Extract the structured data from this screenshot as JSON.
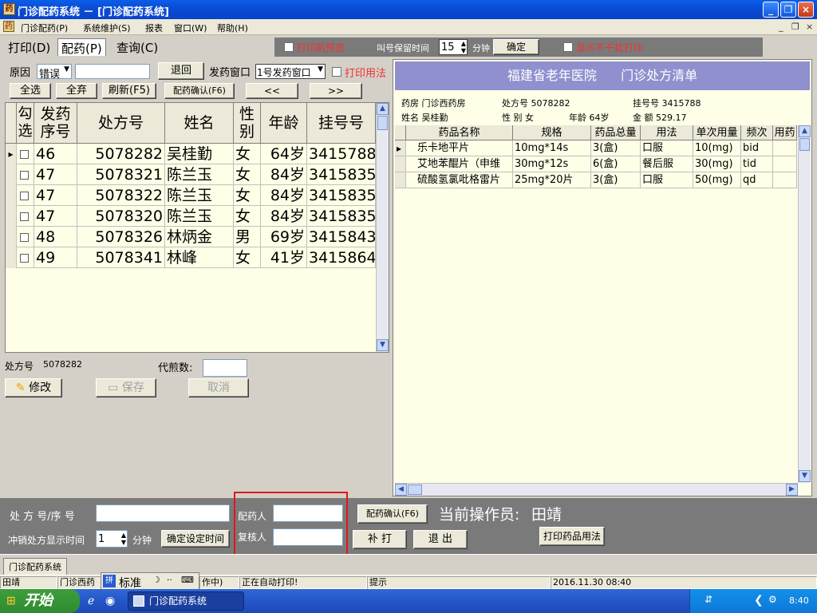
{
  "window": {
    "title": "门诊配药系统 － [门诊配药系统]"
  },
  "menu": [
    "门诊配药(P)",
    "系统维护(S)",
    "报表",
    "窗口(W)",
    "帮助(H)"
  ],
  "mdi_controls": [
    "_",
    "❐",
    "×"
  ],
  "tabs": [
    "打印(D)",
    "配药(P)",
    "查询(C)"
  ],
  "toolbar": {
    "print_preview": "打印前预览",
    "call_keep_label": "叫号保留时间",
    "call_keep_value": "15",
    "minutes": "分钟",
    "confirm": "确定",
    "no_interfere": "显示不干扰打印"
  },
  "left": {
    "reason_label": "原因",
    "reason_value": "错误",
    "return_btn": "退回",
    "window_label": "发药窗口",
    "window_value": "1号发药窗口",
    "print_usage": "打印用法",
    "select_all": "全选",
    "deselect_all": "全弃",
    "refresh": "刷新(F5)",
    "confirm_f6": "配药确认(F6)",
    "prev": "<<",
    "next": ">>",
    "headers": [
      "勾选",
      "发药序号",
      "处方号",
      "姓名",
      "性别",
      "年龄",
      "挂号号"
    ],
    "rows": [
      {
        "seq": "46",
        "rx": "5078282",
        "name": "吴桂勤",
        "sex": "女",
        "age": "64岁",
        "reg": "3415788"
      },
      {
        "seq": "47",
        "rx": "5078321",
        "name": "陈兰玉",
        "sex": "女",
        "age": "84岁",
        "reg": "3415835"
      },
      {
        "seq": "47",
        "rx": "5078322",
        "name": "陈兰玉",
        "sex": "女",
        "age": "84岁",
        "reg": "3415835"
      },
      {
        "seq": "47",
        "rx": "5078320",
        "name": "陈兰玉",
        "sex": "女",
        "age": "84岁",
        "reg": "3415835"
      },
      {
        "seq": "48",
        "rx": "5078326",
        "name": "林炳金",
        "sex": "男",
        "age": "69岁",
        "reg": "3415843"
      },
      {
        "seq": "49",
        "rx": "5078341",
        "name": "林峰",
        "sex": "女",
        "age": "41岁",
        "reg": "3415864"
      }
    ],
    "rx_no_label": "处方号",
    "rx_no_value": "5078282",
    "decoct_label": "代煎数:",
    "modify": "修改",
    "save": "保存",
    "cancel": "取消"
  },
  "right": {
    "hospital": "福建省老年医院",
    "list_title": "门诊处方清单",
    "pharmacy": "药房 门诊西药房",
    "rx": "处方号 5078282",
    "reg": "挂号号 3415788",
    "name": "姓名 吴桂勤",
    "sex": "性  别 女",
    "age": "年龄  64岁",
    "amount": "金  额 529.17",
    "headers": [
      "药品名称",
      "规格",
      "药品总量",
      "用法",
      "单次用量",
      "频次",
      "用药"
    ],
    "rows": [
      {
        "name": "乐卡地平片",
        "spec": "10mg*14s",
        "qty": "3(盒)",
        "usage": "口服",
        "dose": "10(mg)",
        "freq": "bid"
      },
      {
        "name": "艾地苯醌片（申维",
        "spec": "30mg*12s",
        "qty": "6(盒)",
        "usage": "餐后服",
        "dose": "30(mg)",
        "freq": "tid"
      },
      {
        "name": "硫酸氢氯吡格雷片",
        "spec": "25mg*20片",
        "qty": "3(盒)",
        "usage": "口服",
        "dose": "50(mg)",
        "freq": "qd"
      }
    ]
  },
  "bottom": {
    "rx_seq_label": "处 方 号/序  号",
    "clear_time_label": "冲销处方显示时间",
    "clear_time_value": "1",
    "minutes": "分钟",
    "set_time_btn": "确定设定时间",
    "dispenser_label": "配药人",
    "checker_label": "复核人",
    "confirm_f6": "配药确认(F6)",
    "reprint": "补  打",
    "exit": "退  出",
    "operator_label": "当前操作员:",
    "operator": "田靖",
    "print_usage_btn": "打印药品用法"
  },
  "mdi_tab": "门诊配药系统",
  "status": {
    "user": "田靖",
    "dept": "门诊西药",
    "ime": "标准",
    "working": "作中)",
    "auto_print": "正在自动打印!",
    "hint": "提示",
    "datetime": "2016.11.30 08:40"
  },
  "taskbar": {
    "start": "开始",
    "task": "门诊配药系统",
    "clock": "8:40"
  }
}
